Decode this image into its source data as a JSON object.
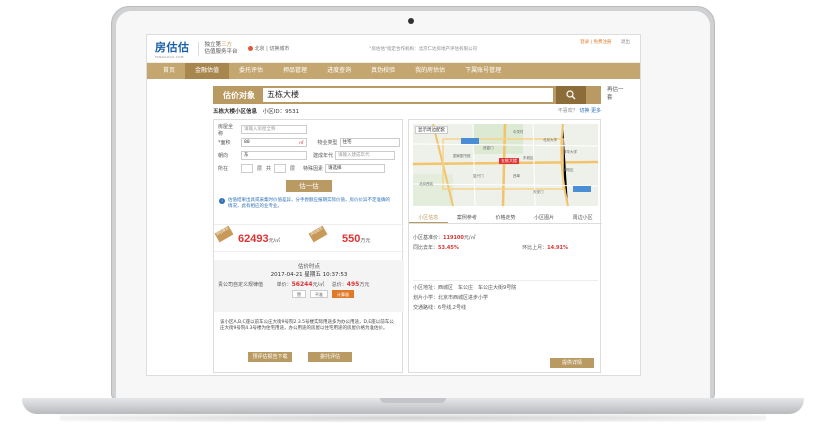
{
  "site": {
    "logo": "房估估",
    "logo_sub": "FANGGUGU.COM",
    "slogan_line1_a": "独立第",
    "slogan_line1_b": "三方",
    "slogan_line2": "估值服务平台",
    "city": "北京 | 切换城市",
    "partner": "\"房估估\"指定合作机构：北京仁达房地产评估有限公司",
    "login": "登录 | 免费注册",
    "logout": "退出"
  },
  "nav": [
    "首页",
    "金融估值",
    "委托评估",
    "押品管理",
    "进度查询",
    "真伪校验",
    "我的房估估",
    "下属账号管理"
  ],
  "search": {
    "title": "估价对象",
    "value": "五栋大楼",
    "side_link": "再估一套"
  },
  "info": {
    "label": "五栋大楼小区信息",
    "id_label": "小区ID：",
    "id_value": "9531",
    "right_a": "不喜欢？",
    "right_b": "切换",
    "right_c": "更多"
  },
  "form": {
    "house_no_label": "房屋全称",
    "house_no_placeholder": "请输入房屋全称",
    "area_label": "*面积",
    "area_value": "88",
    "area_unit": "㎡",
    "property_label": "物业类型",
    "property_value": "住宅",
    "orientation_label": "朝向",
    "orientation_value": "东",
    "build_year_label": "建成年代",
    "build_year_placeholder": "请输入建成年代",
    "floor_label": "所在",
    "floor_a": "层",
    "floor_b": "共",
    "floor_c": "层",
    "special_label": "特殊因素",
    "special_value": "请选择",
    "submit": "估一估",
    "notice": "估值结果出具或采集时价值差异，分手尝额应报期实际价值，房价价异不定准确的情况，此有相应的业专业。"
  },
  "price": {
    "unit_tag": "评估单价",
    "unit_price": "62493",
    "unit_price_unit": "元/㎡",
    "total_tag": "评估总价",
    "total_price": "550",
    "total_price_unit": "万元"
  },
  "estimate": {
    "time_label": "估价时点",
    "time_value": "2017-04-21 星期五 10:37:53",
    "user_label": "贵公司自定义规律值",
    "user_price_label": "单价：",
    "user_price": "56244",
    "user_price_unit": "元/㎡",
    "user_total_label": "总价：",
    "user_total": "495",
    "user_total_unit": "万元",
    "btn_like": "赞",
    "btn_dislike": "不准",
    "btn_calc": "计算器"
  },
  "desc": "该小区A,B,C座以前车公庄大街9号院2.3.5号楼实际用途多为办公用途，D,E座以前车公庄大街9号院4.3号楼为住宅用途，办公用途的房屋以住宅用途的房屋价格为准估价。",
  "bottom_buttons": [
    "预评估报告下载",
    "委托评估"
  ],
  "map": {
    "layer_label": "显示周边配套",
    "marker": "五栋大楼",
    "places": [
      "北京西站",
      "西直门",
      "中关村",
      "北京大学",
      "清华大学",
      "国家图书馆",
      "复兴门",
      "西单",
      "天安门",
      "朝阳区",
      "东城区"
    ]
  },
  "tabs": [
    "小区信息",
    "案例参考",
    "价格走势",
    "小区图片",
    "周边小区"
  ],
  "stats": {
    "base_price_label": "小区基准价：",
    "base_price": "119100",
    "base_price_unit": "元/㎡",
    "yoy_label": "同比去年：",
    "yoy": "53.45%",
    "mom_label": "环比上月：",
    "mom": "14.91%"
  },
  "address": {
    "addr_label": "小区地址：",
    "addr": "西城区　车公庄　车公庄大街9号院",
    "school_label": "划片小学：",
    "school": "北京市西城区进步小学",
    "metro_label": "交通路线：",
    "metro": "6号线,2号线",
    "details_btn": "提供详情"
  }
}
